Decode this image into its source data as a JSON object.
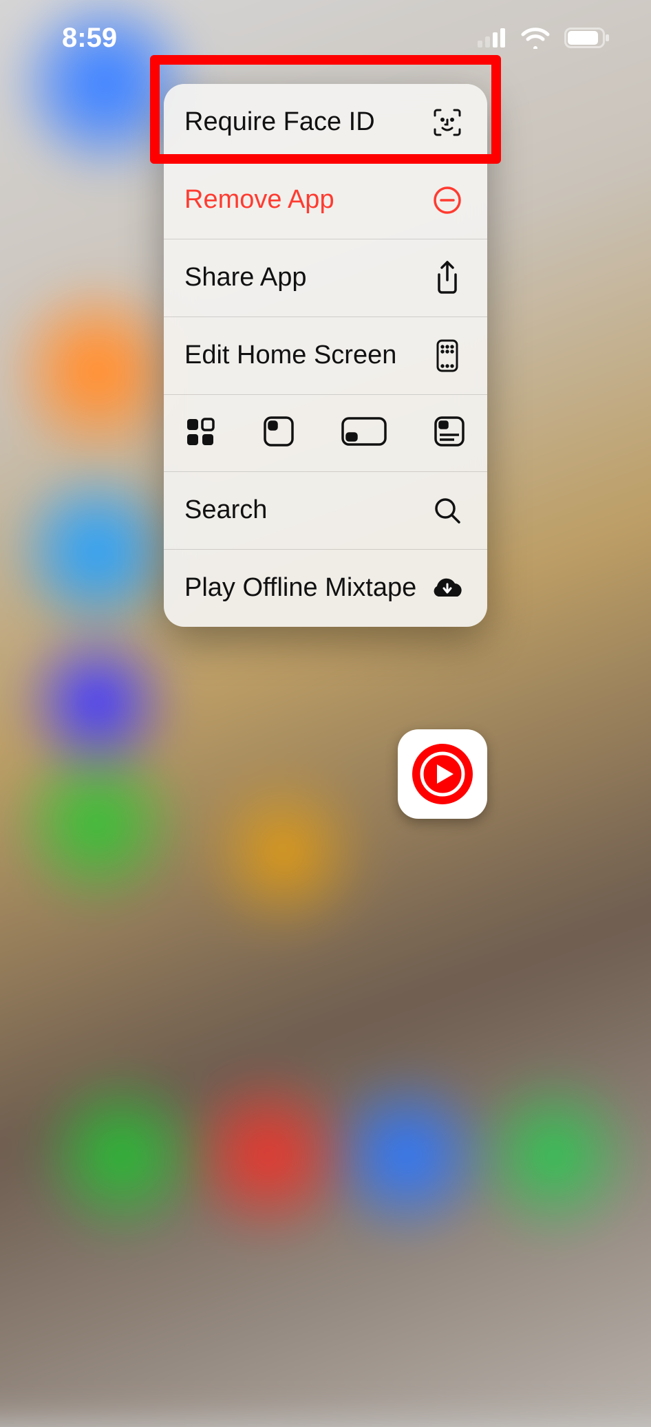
{
  "status_bar": {
    "time": "8:59"
  },
  "menu": {
    "require_face_id": "Require Face ID",
    "remove_app": "Remove App",
    "share_app": "Share App",
    "edit_home_screen": "Edit Home Screen",
    "search": "Search",
    "play_offline_mixtape": "Play Offline Mixtape"
  },
  "highlight_color": "#ff0000",
  "destructive_color": "#ff3b30"
}
